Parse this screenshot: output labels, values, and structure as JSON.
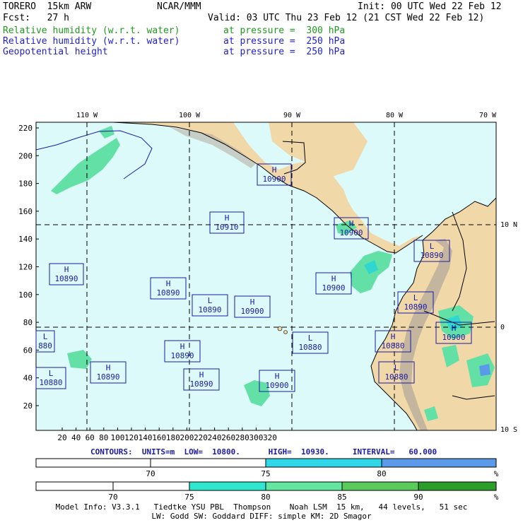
{
  "header": {
    "model": "TORERO  15km ARW",
    "org": "NCAR/MMM",
    "init": "Init: 00 UTC Wed 22 Feb 12",
    "fcst": "Fcst:   27 h",
    "valid": "Valid: 03 UTC Thu 23 Feb 12 (21 CST Wed 22 Feb 12)",
    "fields": [
      {
        "name": "Relative humidity (w.r.t. water)",
        "level": "at pressure =  300 hPa",
        "color": "#1f9a1f"
      },
      {
        "name": "Relative humidity (w.r.t. water)",
        "level": "at pressure =  250 hPa",
        "color": "#1f1fd0"
      },
      {
        "name": "Geopotential height",
        "level": "at pressure =  250 hPa",
        "color": "#1f1fd0"
      }
    ]
  },
  "map": {
    "top_lon_labels": [
      "110 W",
      "100 W",
      "90 W",
      "80 W",
      "70 W"
    ],
    "right_lat_labels": [
      "10 N",
      "0",
      "10 S"
    ],
    "left_ticks": [
      "220",
      "200",
      "180",
      "160",
      "140",
      "120",
      "100",
      "80",
      "60",
      "40",
      "20"
    ],
    "bottom_ticks": [
      "20",
      "40",
      "60",
      "80",
      "100",
      "120",
      "140",
      "160",
      "180",
      "200",
      "220",
      "240",
      "260",
      "280",
      "300",
      "320"
    ],
    "centers": [
      {
        "type": "H",
        "value": "10900"
      },
      {
        "type": "H",
        "value": "10910"
      },
      {
        "type": "H",
        "value": "10890"
      },
      {
        "type": "L",
        "value": "10890"
      },
      {
        "type": "H",
        "value": "10890"
      },
      {
        "type": "H",
        "value": "10900"
      },
      {
        "type": "L",
        "value": "10890"
      },
      {
        "type": "H",
        "value": "10900"
      },
      {
        "type": "L",
        "value": "10890"
      },
      {
        "type": "H",
        "value": "10900"
      },
      {
        "type": "L",
        "value": "10880"
      },
      {
        "type": "H",
        "value": "10890"
      },
      {
        "type": "H",
        "value": "10880"
      },
      {
        "type": "H",
        "value": "10900"
      },
      {
        "type": "L",
        "value": "880"
      },
      {
        "type": "L",
        "value": "10880"
      },
      {
        "type": "H",
        "value": "10890"
      },
      {
        "type": "H",
        "value": "10890"
      },
      {
        "type": "H",
        "value": "10900"
      },
      {
        "type": "L",
        "value": "10880"
      }
    ],
    "colors": {
      "ocean": "#ddfafa",
      "land": "#f1d8a8",
      "mountain": "#b4aa9c",
      "rh_light": "#63e0a6",
      "rh_mid": "#2fd7cf",
      "contour": "#1a1aa8"
    }
  },
  "contours": "CONTOURS:  UNITS=m  LOW=  10800.      HIGH=  10930.     INTERVAL=   60.000",
  "bar1": {
    "labels": [
      "70",
      "75",
      "80",
      "%"
    ],
    "colors": [
      "#ffffff",
      "#ffffff",
      "#2fd7e8",
      "#5a9ae8"
    ]
  },
  "bar2": {
    "labels": [
      "70",
      "75",
      "80",
      "85",
      "90",
      "%"
    ],
    "colors": [
      "#ffffff",
      "#ffffff",
      "#2fe6cf",
      "#63e6a0",
      "#5acb5a",
      "#2a9d2a"
    ]
  },
  "footer": {
    "line1": "Model Info: V3.3.1   Tiedtke YSU PBL  Thompson    Noah LSM  15 km,   44 levels,   51 sec",
    "line2": "LW: Godd SW: Goddard DIFF: simple KM: 2D Smagor"
  }
}
